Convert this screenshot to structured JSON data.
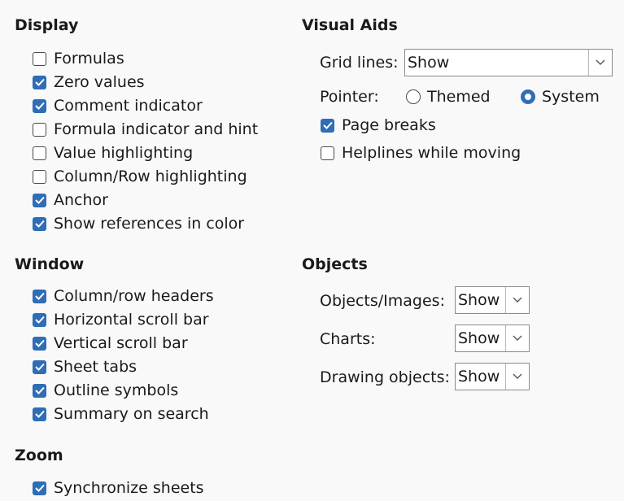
{
  "display": {
    "title": "Display",
    "items": [
      {
        "label": "Formulas",
        "checked": false
      },
      {
        "label": "Zero values",
        "checked": true
      },
      {
        "label": "Comment indicator",
        "checked": true
      },
      {
        "label": "Formula indicator and hint",
        "checked": false
      },
      {
        "label": "Value highlighting",
        "checked": false
      },
      {
        "label": "Column/Row highlighting",
        "checked": false
      },
      {
        "label": "Anchor",
        "checked": true
      },
      {
        "label": "Show references in color",
        "checked": true
      }
    ]
  },
  "window": {
    "title": "Window",
    "items": [
      {
        "label": "Column/row headers",
        "checked": true
      },
      {
        "label": "Horizontal scroll bar",
        "checked": true
      },
      {
        "label": "Vertical scroll bar",
        "checked": true
      },
      {
        "label": "Sheet tabs",
        "checked": true
      },
      {
        "label": "Outline symbols",
        "checked": true
      },
      {
        "label": "Summary on search",
        "checked": true
      }
    ]
  },
  "zoom": {
    "title": "Zoom",
    "items": [
      {
        "label": "Synchronize sheets",
        "checked": true
      }
    ]
  },
  "visual_aids": {
    "title": "Visual Aids",
    "grid_lines_label": "Grid lines:",
    "grid_lines_value": "Show",
    "pointer_label": "Pointer:",
    "pointer_themed": "Themed",
    "pointer_system": "System",
    "pointer_selected": "System",
    "page_breaks": {
      "label": "Page breaks",
      "checked": true
    },
    "helplines": {
      "label": "Helplines while moving",
      "checked": false
    }
  },
  "objects": {
    "title": "Objects",
    "objects_images_label": "Objects/Images:",
    "objects_images_value": "Show",
    "charts_label": "Charts:",
    "charts_value": "Show",
    "drawing_objects_label": "Drawing objects:",
    "drawing_objects_value": "Show"
  },
  "colors": {
    "accent": "#2f6db5"
  }
}
